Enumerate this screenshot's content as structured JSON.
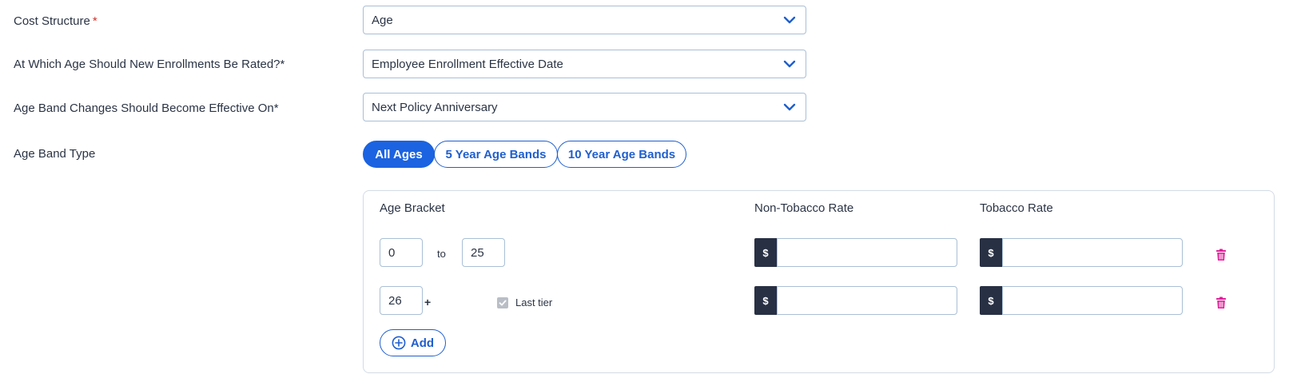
{
  "fields": {
    "cost_structure": {
      "label": "Cost Structure",
      "required_mark": "*",
      "value": "Age"
    },
    "rating_age": {
      "label": "At Which Age Should New Enrollments Be Rated?*",
      "value": "Employee Enrollment Effective Date"
    },
    "band_effective": {
      "label": "Age Band Changes Should Become Effective On*",
      "value": "Next Policy Anniversary"
    },
    "band_type": {
      "label": "Age Band Type",
      "options": [
        "All Ages",
        "5 Year Age Bands",
        "10 Year Age Bands"
      ],
      "selected": "All Ages"
    }
  },
  "table": {
    "headers": {
      "age_bracket": "Age Bracket",
      "non_tobacco": "Non-Tobacco Rate",
      "tobacco": "Tobacco Rate"
    },
    "currency_symbol": "$",
    "rows": [
      {
        "from": "0",
        "separator": "to",
        "to": "25",
        "non_tobacco": "",
        "tobacco": ""
      },
      {
        "from": "26",
        "plus": "+",
        "last_tier_label": "Last tier",
        "last_tier_checked": true,
        "non_tobacco": "",
        "tobacco": ""
      }
    ],
    "add_label": "Add"
  },
  "colors": {
    "accent": "#1b63e0",
    "delete": "#e0219a",
    "currency_bg": "#283044"
  },
  "icons": {
    "select_chevron": "chevron-down-icon",
    "delete": "trash-icon",
    "add": "plus-circle-icon",
    "checkbox": "check-icon"
  }
}
